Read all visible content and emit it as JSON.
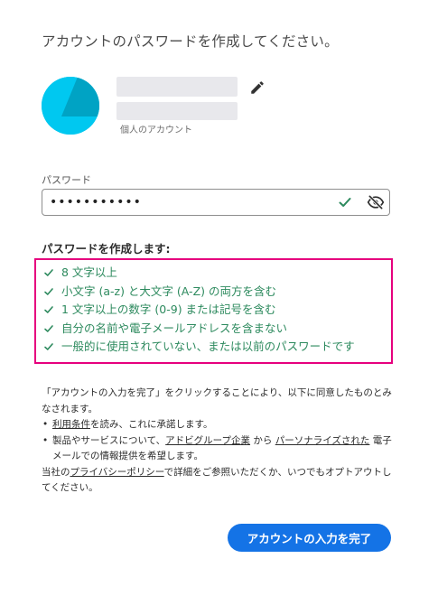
{
  "header": {
    "title": "アカウントのパスワードを作成してください。"
  },
  "account": {
    "type_label": "個人のアカウント",
    "avatar_color": "#00c8f0",
    "avatar_shadow_color": "#00a3c4"
  },
  "password": {
    "label": "パスワード",
    "value": "•••••••••••",
    "valid_icon": "check-icon",
    "toggle_icon": "eye-slash-icon"
  },
  "requirements": {
    "title": "パスワードを作成します:",
    "highlight_color": "#e6007e",
    "ok_color": "#2d8a5e",
    "items": [
      "8 文字以上",
      "小文字 (a-z) と大文字 (A-Z) の両方を含む",
      "1 文字以上の数字 (0-9) または記号を含む",
      "自分の名前や電子メールアドレスを含まない",
      "一般的に使用されていない、または以前のパスワードです"
    ]
  },
  "terms": {
    "intro": "「アカウントの入力を完了」をクリックすることにより、以下に同意したものとみなされます。",
    "item1_link": "利用条件",
    "item1_text": "を読み、これに承諾します。",
    "item2_pre": "製品やサービスについて、",
    "item2_link1": "アドビグループ企業",
    "item2_mid": " から ",
    "item2_link2": "パーソナライズされた",
    "item2_post": " 電子メールでの情報提供を希望します。",
    "privacy_pre": "当社の",
    "privacy_link": "プライバシーポリシー",
    "privacy_post": "で詳細をご参照いただくか、いつでもオプトアウトしてください。"
  },
  "submit": {
    "label": "アカウントの入力を完了",
    "color": "#1473e6"
  }
}
